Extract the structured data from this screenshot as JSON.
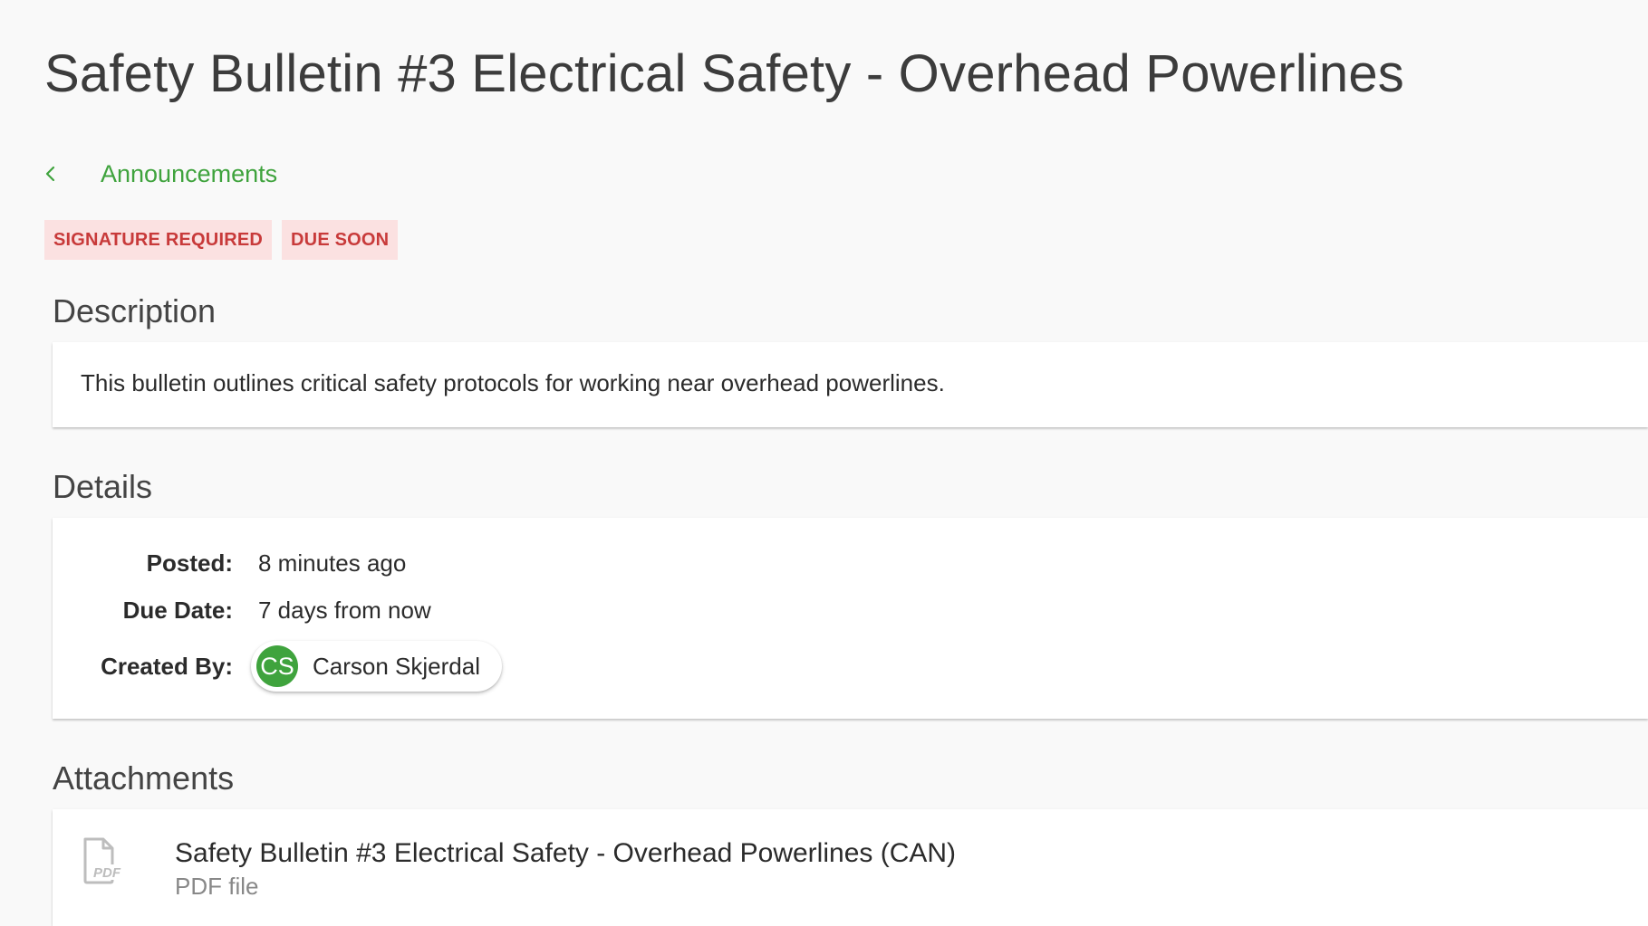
{
  "page": {
    "title": "Safety Bulletin #3 Electrical Safety - Overhead Powerlines"
  },
  "breadcrumb": {
    "label": "Announcements",
    "icon": "chevron-left-icon",
    "color": "#3fa33d"
  },
  "badges": [
    {
      "label": "SIGNATURE REQUIRED"
    },
    {
      "label": "DUE SOON"
    }
  ],
  "badge_colors": {
    "background": "#fbe1e1",
    "text": "#c83a3a"
  },
  "description": {
    "heading": "Description",
    "text": "This bulletin outlines critical safety protocols for working near overhead powerlines."
  },
  "details": {
    "heading": "Details",
    "posted_label": "Posted:",
    "posted_value": "8 minutes ago",
    "due_label": "Due Date:",
    "due_value": "7 days from now",
    "created_label": "Created By:",
    "creator": {
      "initials": "CS",
      "name": "Carson Skjerdal",
      "avatar_color": "#3fa33d"
    }
  },
  "attachments": {
    "heading": "Attachments",
    "items": [
      {
        "icon": "pdf-file-icon",
        "icon_label": "PDF",
        "title": "Safety Bulletin #3 Electrical Safety - Overhead Powerlines (CAN)",
        "type": "PDF file"
      }
    ]
  }
}
